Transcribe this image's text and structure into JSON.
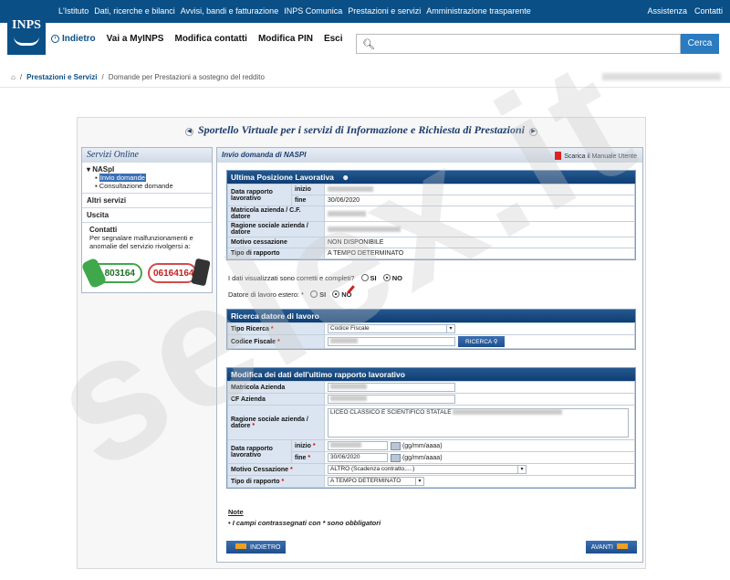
{
  "topbar": {
    "menu": [
      "L'Istituto",
      "Dati, ricerche e bilanci",
      "Avvisi, bandi e fatturazione",
      "INPS Comunica",
      "Prestazioni e servizi",
      "Amministrazione trasparente"
    ],
    "assistenza": "Assistenza",
    "contatti": "Contatti"
  },
  "logo": "INPS",
  "nav": {
    "back": "Indietro",
    "myinps": "Vai a MyINPS",
    "contatti": "Modifica contatti",
    "pin": "Modifica PIN",
    "esci": "Esci"
  },
  "search": {
    "placeholder": "",
    "button": "Cerca"
  },
  "breadcrumb": {
    "l1": "Prestazioni e Servizi",
    "l2": "Domande per Prestazioni a sostegno del reddito"
  },
  "panel_title": "Sportello Virtuale per i servizi di Informazione e Richiesta di Prestazioni",
  "sidebar": {
    "title": "Servizi Online",
    "section1": "NASpI",
    "item1": "Invio domande",
    "item2": "Consultazione domande",
    "section2": "Altri servizi",
    "section3": "Uscita",
    "contatti_title": "Contatti",
    "contatti_text": "Per segnalare malfunzionamenti e anomalie del servizio rivolgersi a:",
    "phone1": "803164",
    "phone2": "06164164"
  },
  "main": {
    "header": "Invio domanda di NASPI",
    "manual": "Scarica il Manuale Utente"
  },
  "last_position": {
    "title": "Ultima Posizione Lavorativa",
    "data_rapporto": "Data rapporto lavorativo",
    "inizio": "inizio",
    "fine": "fine",
    "fine_val": "30/06/2020",
    "matricola": "Matricola azienda / C.F. datore",
    "ragione": "Ragione sociale azienda / datore",
    "motivo": "Motivo cessazione",
    "motivo_val": "NON DISPONIBILE",
    "tipo": "Tipo di rapporto",
    "tipo_val": "A TEMPO DETERMINATO"
  },
  "questions": {
    "q1": "I dati visualizzati sono corretti e completi?",
    "q2": "Datore di lavoro estero: *",
    "si": "SI",
    "no": "NO"
  },
  "ricerca": {
    "title": "Ricerca datore di lavoro",
    "tipo": "Tipo Ricerca",
    "tipo_val": "Codice Fiscale",
    "cf": "Codice Fiscale",
    "btn": "RICERCA"
  },
  "modifica": {
    "title": "Modifica dei dati dell'ultimo rapporto lavorativo",
    "matricola": "Matricola Azienda",
    "cf": "CF Azienda",
    "ragione": "Ragione sociale azienda / datore",
    "ragione_val": "LICEO CLASSICO E SCIENTIFICO STATALE",
    "data": "Data rapporto lavorativo",
    "inizio": "inizio",
    "fine": "fine",
    "fine_val": "30/06/2020",
    "fmt": "(gg/mm/aaaa)",
    "motivo": "Motivo Cessazione",
    "motivo_val": "ALTRO (Scadenza contratto,....)",
    "tipo": "Tipo di rapporto",
    "tipo_val": "A TEMPO DETERMINATO"
  },
  "note": {
    "title": "Note",
    "text": "I campi contrassegnati con * sono obbligatori"
  },
  "buttons": {
    "back": "INDIETRO",
    "next": "AVANTI"
  },
  "watermark": "selex.it"
}
